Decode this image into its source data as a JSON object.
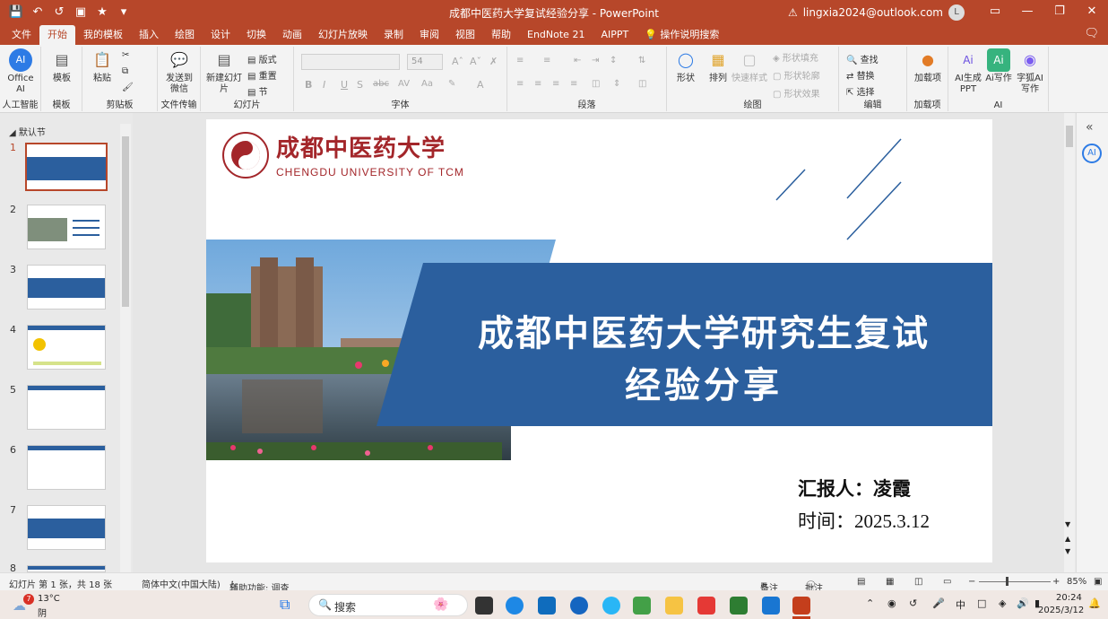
{
  "window": {
    "title": "成都中医药大学复试经验分享 - PowerPoint",
    "account": "lingxia2024@outlook.com",
    "avatar_initial": "L"
  },
  "quick_access": {
    "save_icon": "save-icon",
    "undo_icon": "undo-icon",
    "redo_icon": "redo-icon"
  },
  "tabs": [
    "文件",
    "开始",
    "我的模板",
    "插入",
    "绘图",
    "设计",
    "切换",
    "动画",
    "幻灯片放映",
    "录制",
    "审阅",
    "视图",
    "帮助",
    "EndNote 21",
    "AIPPT",
    "操作说明搜索"
  ],
  "active_tab": "开始",
  "ribbon": {
    "office_ai": "Office AI",
    "group_ai": "人工智能",
    "template": "模板",
    "group_template": "模板",
    "paste": "粘贴",
    "group_clipboard": "剪贴板",
    "send_wechat": "发送到微信",
    "group_file": "文件传输",
    "new_slide": "新建幻灯片",
    "layout": "版式",
    "reset": "重置",
    "section": "节",
    "group_slides": "幻灯片",
    "font_size": "54",
    "group_font": "字体",
    "group_paragraph": "段落",
    "shape": "形状",
    "arrange": "排列",
    "quick_style": "快速样式",
    "shape_fill": "形状填充",
    "shape_outline": "形状轮廓",
    "shape_effect": "形状效果",
    "group_drawing": "绘图",
    "find": "查找",
    "replace": "替换",
    "select": "选择",
    "group_editing": "编辑",
    "addin": "加载项",
    "group_addin": "加载项",
    "ai_ppt": "AI生成PPT",
    "ai_write": "Ai写作",
    "zihu": "字狐AI写作",
    "group_ai2": "AI"
  },
  "thumbnails": {
    "section_name": "默认节",
    "numbers": [
      "1",
      "2",
      "3",
      "4",
      "5",
      "6",
      "7",
      "8"
    ]
  },
  "slide": {
    "logo_text_cn": "成都中医药大学",
    "logo_text_en": "CHENGDU UNIVERSITY OF TCM",
    "title_line1": "成都中医药大学研究生复试",
    "title_line2": "经验分享",
    "reporter": "汇报人：凌霞",
    "date": "时间：2025.3.12"
  },
  "statusbar": {
    "slide_info": "幻灯片 第 1 张，共 18 张",
    "language": "简体中文(中国大陆)",
    "accessibility": "辅助功能: 调查",
    "notes": "备注",
    "comments": "批注",
    "zoom": "85%"
  },
  "taskbar": {
    "weather_temp": "13°C",
    "weather_desc": "阴",
    "search_placeholder": "搜索",
    "time": "20:24",
    "date": "2025/3/12",
    "ime": "中"
  }
}
